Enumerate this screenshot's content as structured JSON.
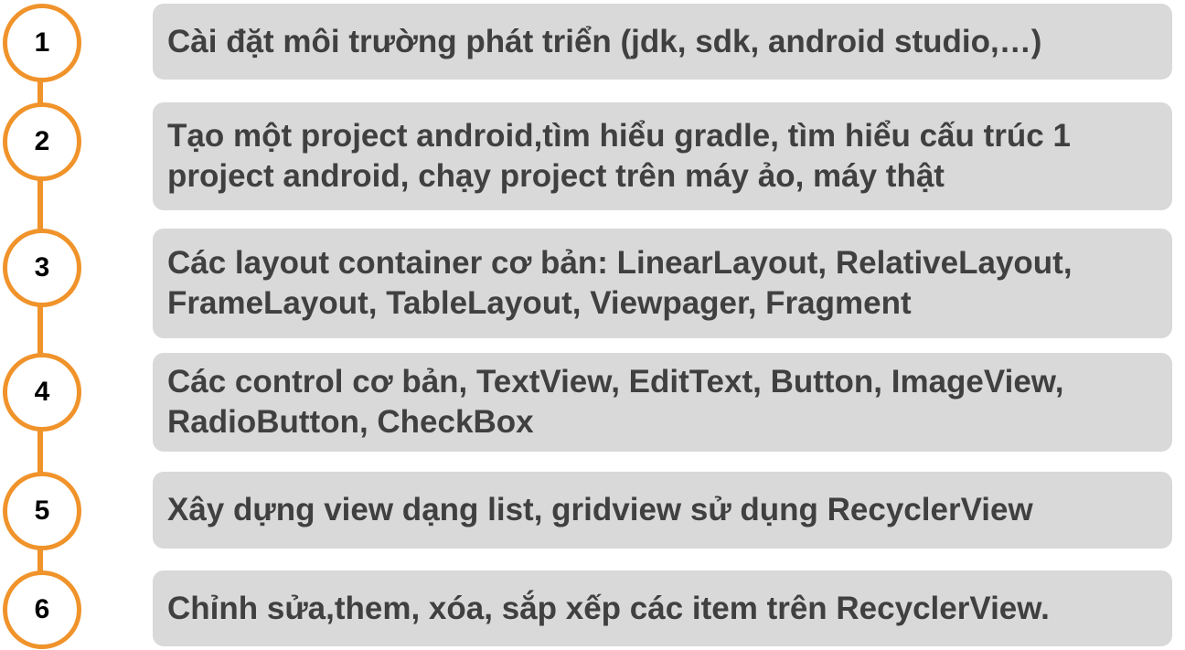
{
  "colors": {
    "accent": "#f0932b",
    "box_background": "#d9d9d9",
    "text": "#404040"
  },
  "steps": [
    {
      "number": "1",
      "text": "Cài đặt môi trường phát triển (jdk, sdk, android studio,…)"
    },
    {
      "number": "2",
      "text": "Tạo một project android,tìm hiểu gradle, tìm hiểu cấu trúc 1\nproject android, chạy project trên máy ảo, máy thật"
    },
    {
      "number": "3",
      "text": "Các layout container cơ bản: LinearLayout, RelativeLayout,\nFrameLayout, TableLayout, Viewpager, Fragment"
    },
    {
      "number": "4",
      "text": "Các control cơ bản, TextView, EditText, Button, ImageView,\nRadioButton, CheckBox"
    },
    {
      "number": "5",
      "text": "Xây dựng view dạng list, gridview sử dụng RecyclerView"
    },
    {
      "number": "6",
      "text": "Chỉnh sửa,them, xóa, sắp xếp các item trên RecyclerView."
    }
  ]
}
